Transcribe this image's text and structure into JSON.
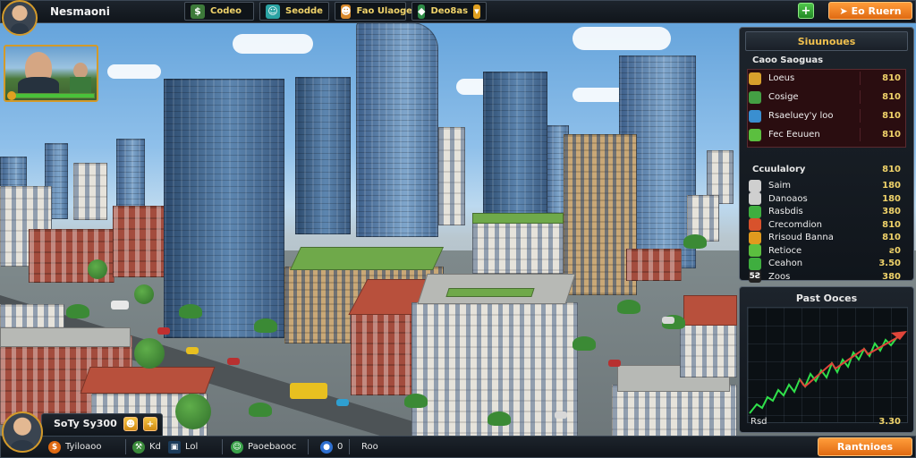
{
  "player": {
    "name": "Nesmaoni"
  },
  "resources": [
    {
      "value": "Codeo",
      "icon": "cash-icon",
      "color": "#3d7a3a",
      "glyph": "$"
    },
    {
      "value": "Seodde",
      "icon": "population-icon",
      "color": "#2aa3a3",
      "glyph": "☺"
    },
    {
      "value": "Fao Ulaoge",
      "icon": "happiness-icon",
      "color": "#d8892c",
      "glyph": "☻"
    },
    {
      "value": "Deo8as",
      "icon": "shield-icon",
      "color": "#2e8b47",
      "glyph": "◆"
    }
  ],
  "top_right": {
    "add_label": "+",
    "action_label": "Eo Ruern"
  },
  "city_stats": {
    "title": "Siuunoues",
    "section_heading": "Caoo Saoguas",
    "highlight_rows": [
      {
        "label": "Loeus",
        "value": "810",
        "icon": "building-icon",
        "icon_color": "#d8a12c"
      },
      {
        "label": "Cosige",
        "value": "810",
        "icon": "house-icon",
        "icon_color": "#44a044"
      },
      {
        "label": "Rsaeluey'y loo",
        "value": "810",
        "icon": "drop-icon",
        "icon_color": "#3a8fd0"
      },
      {
        "label": "Fec Eeuuen",
        "value": "810",
        "icon": "leaf-icon",
        "icon_color": "#5bbf3f"
      }
    ],
    "subheading": "Ccuulalory",
    "subheading_value": "810",
    "rows": [
      {
        "label": "Saim",
        "value": "180",
        "icon": "check-icon",
        "icon_color": "#cfcfcf"
      },
      {
        "label": "Danoaos",
        "value": "180",
        "icon": "check-icon",
        "icon_color": "#cfcfcf"
      },
      {
        "label": "Rasbdis",
        "value": "380",
        "icon": "coin-icon",
        "icon_color": "#3fae3f"
      },
      {
        "label": "Crecomdion",
        "value": "810",
        "icon": "coin-icon",
        "icon_color": "#d8522c"
      },
      {
        "label": "Rrisoud Banna",
        "value": "810",
        "icon": "coin-icon",
        "icon_color": "#e09a1e"
      },
      {
        "label": "Retioce",
        "value": "ƨ0",
        "icon": "leaf-icon",
        "icon_color": "#5bbf3f"
      },
      {
        "label": "Ceahon",
        "value": "3.50",
        "icon": "coin-icon",
        "icon_color": "#3fae3f"
      },
      {
        "label": "Zoos",
        "value": "380",
        "icon": "counter-icon",
        "icon_color": "#222222",
        "glyph": "5Ꙅ"
      }
    ]
  },
  "graph": {
    "title": "Past Ooces",
    "footer_left": "Rsd",
    "footer_right": "3.30",
    "line_color": "#2fe04a",
    "accent_color": "#e0453a"
  },
  "bottom": {
    "mayor_name": "SoTy Sy300",
    "slots": [
      {
        "label": "Tyiloaoo",
        "icon": "coin-icon",
        "color": "#e06a12",
        "glyph": "$"
      },
      {
        "label": "Kd",
        "icon": "tool-icon",
        "color": "#3a8a3a",
        "glyph": "⚒"
      },
      {
        "label": "Lol",
        "icon": "map-icon",
        "color": "#1b3b5a",
        "glyph": "▣"
      },
      {
        "label": "Paoebaooc",
        "icon": "people-icon",
        "color": "#3aa24a",
        "glyph": "☺"
      },
      {
        "label": "0",
        "icon": "water-icon",
        "color": "#2e6fd0",
        "glyph": "●"
      },
      {
        "label": "Roo",
        "icon": "grid-icon",
        "color": "#222",
        "glyph": ""
      }
    ],
    "action_label": "Rantnioes"
  },
  "minimap": {
    "label": "people"
  }
}
